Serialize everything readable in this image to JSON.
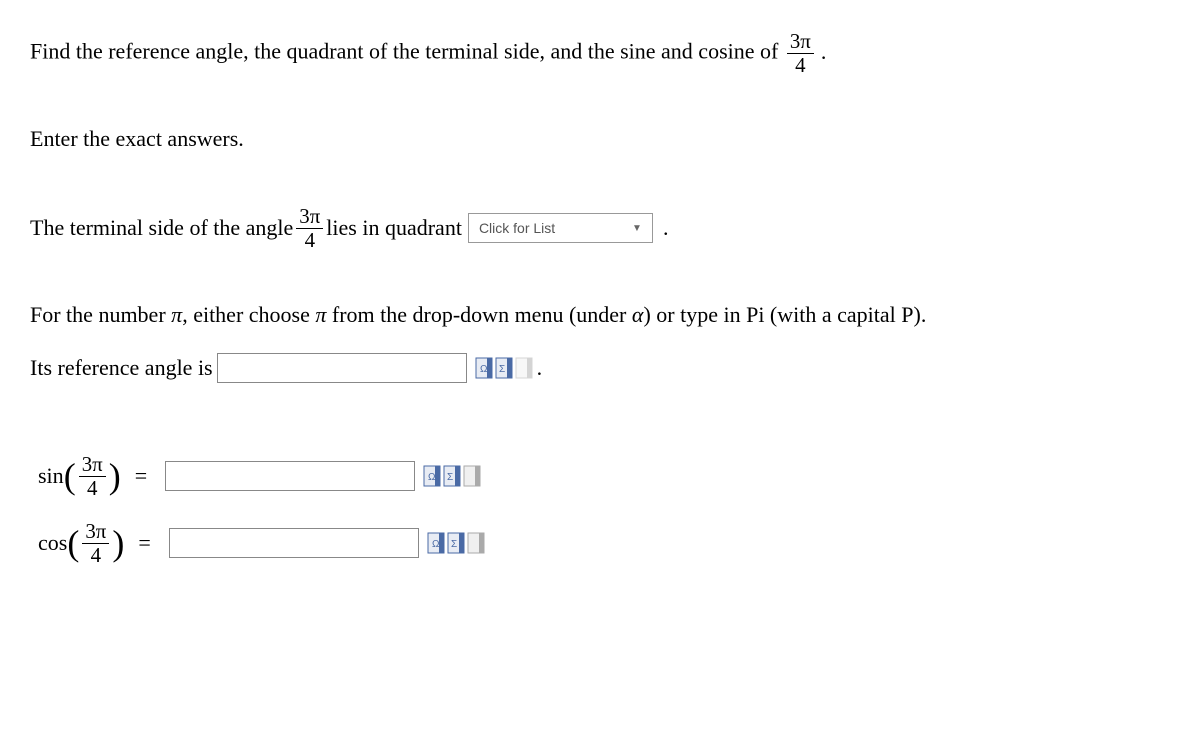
{
  "question": {
    "prefix": "Find the reference angle, the quadrant of the terminal side, and the sine and cosine of ",
    "angle_num": "3π",
    "angle_den": "4",
    "suffix": "."
  },
  "instruction1": "Enter the exact answers.",
  "quadrant": {
    "prefix": "The terminal side of the angle ",
    "angle_num": "3π",
    "angle_den": "4",
    "middle": " lies in quadrant ",
    "dropdown_placeholder": "Click for List",
    "suffix": "."
  },
  "pi_instruction": {
    "part1": "For the number ",
    "pi1": "π",
    "part2": ", either choose ",
    "pi2": "π",
    "part3": " from the drop-down menu (under ",
    "alpha": "α",
    "part4": ") or type in Pi (with a capital P)."
  },
  "reference": {
    "label": "Its reference angle is ",
    "suffix": "."
  },
  "sin_eq": {
    "func": "sin",
    "num": "3π",
    "den": "4",
    "equals": "="
  },
  "cos_eq": {
    "func": "cos",
    "num": "3π",
    "den": "4",
    "equals": "="
  }
}
